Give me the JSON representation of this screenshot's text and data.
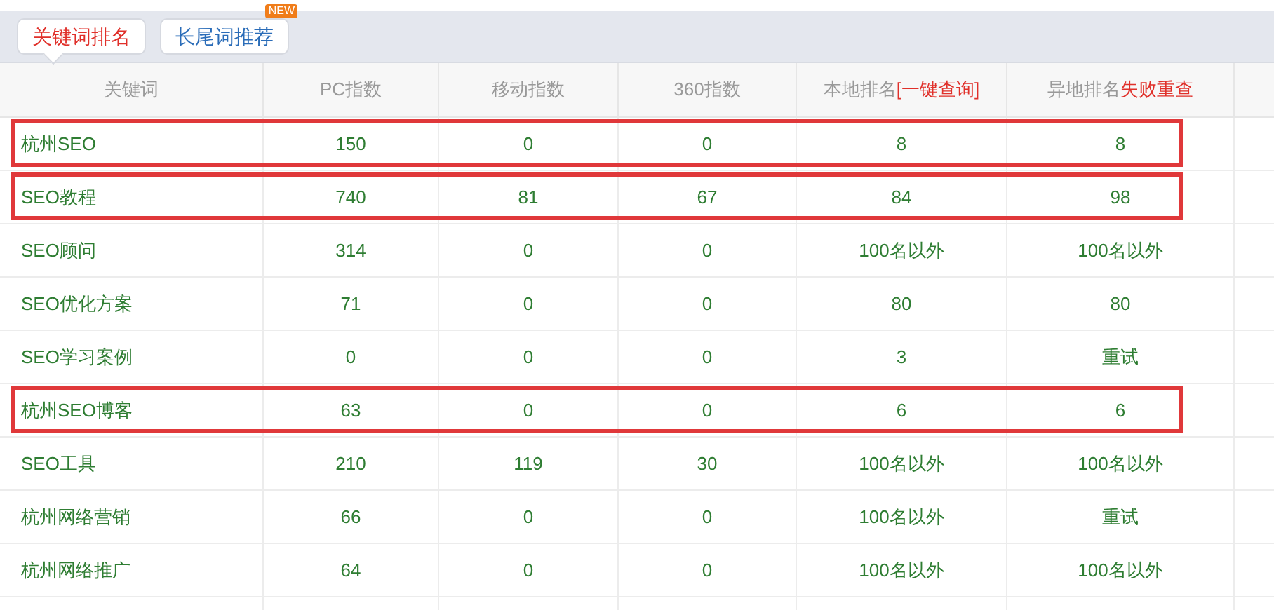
{
  "tabs": [
    {
      "label": "关键词排名",
      "selected": true
    },
    {
      "label": "长尾词推荐",
      "selected": false,
      "badge": "NEW"
    }
  ],
  "table": {
    "columns": [
      {
        "label": "关键词"
      },
      {
        "label": "PC指数"
      },
      {
        "label": "移动指数"
      },
      {
        "label": "360指数"
      },
      {
        "label": "本地排名",
        "action": "[一键查询]"
      },
      {
        "label": "异地排名",
        "action": "失败重查"
      }
    ],
    "rows": [
      {
        "highlighted": true,
        "cells": [
          "杭州SEO",
          "150",
          "0",
          "0",
          "8",
          "8"
        ]
      },
      {
        "highlighted": true,
        "cells": [
          "SEO教程",
          "740",
          "81",
          "67",
          "84",
          "98"
        ]
      },
      {
        "highlighted": false,
        "cells": [
          "SEO顾问",
          "314",
          "0",
          "0",
          "100名以外",
          "100名以外"
        ]
      },
      {
        "highlighted": false,
        "cells": [
          "SEO优化方案",
          "71",
          "0",
          "0",
          "80",
          "80"
        ]
      },
      {
        "highlighted": false,
        "cells": [
          "SEO学习案例",
          "0",
          "0",
          "0",
          "3",
          "重试"
        ]
      },
      {
        "highlighted": true,
        "cells": [
          "杭州SEO博客",
          "63",
          "0",
          "0",
          "6",
          "6"
        ]
      },
      {
        "highlighted": false,
        "cells": [
          "SEO工具",
          "210",
          "119",
          "30",
          "100名以外",
          "100名以外"
        ]
      },
      {
        "highlighted": false,
        "cells": [
          "杭州网络营销",
          "66",
          "0",
          "0",
          "100名以外",
          "重试"
        ]
      },
      {
        "highlighted": false,
        "cells": [
          "杭州网络推广",
          "64",
          "0",
          "0",
          "100名以外",
          "100名以外"
        ]
      }
    ]
  }
}
